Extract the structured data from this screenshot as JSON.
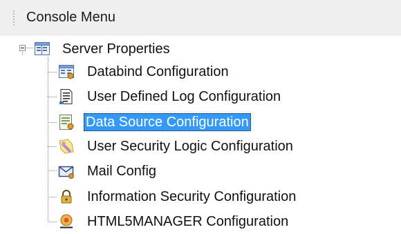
{
  "panel": {
    "title": "Console Menu"
  },
  "tree": {
    "root": {
      "label": "Server Properties",
      "icon": "server-properties-icon",
      "expanded": true
    },
    "children": [
      {
        "label": "Databind Configuration",
        "icon": "databind-config-icon",
        "selected": false
      },
      {
        "label": "User Defined Log Configuration",
        "icon": "log-document-icon",
        "selected": false
      },
      {
        "label": "Data Source Configuration",
        "icon": "data-source-icon",
        "selected": true
      },
      {
        "label": "User Security Logic Configuration",
        "icon": "security-key-icon",
        "selected": false
      },
      {
        "label": "Mail Config",
        "icon": "mail-icon",
        "selected": false
      },
      {
        "label": "Information Security Configuration",
        "icon": "lock-icon",
        "selected": false
      },
      {
        "label": "HTML5MANAGER Configuration",
        "icon": "html5-manager-icon",
        "selected": false
      }
    ]
  },
  "colors": {
    "selection": "#3399ff",
    "header_bg": "#f0f0f0"
  }
}
